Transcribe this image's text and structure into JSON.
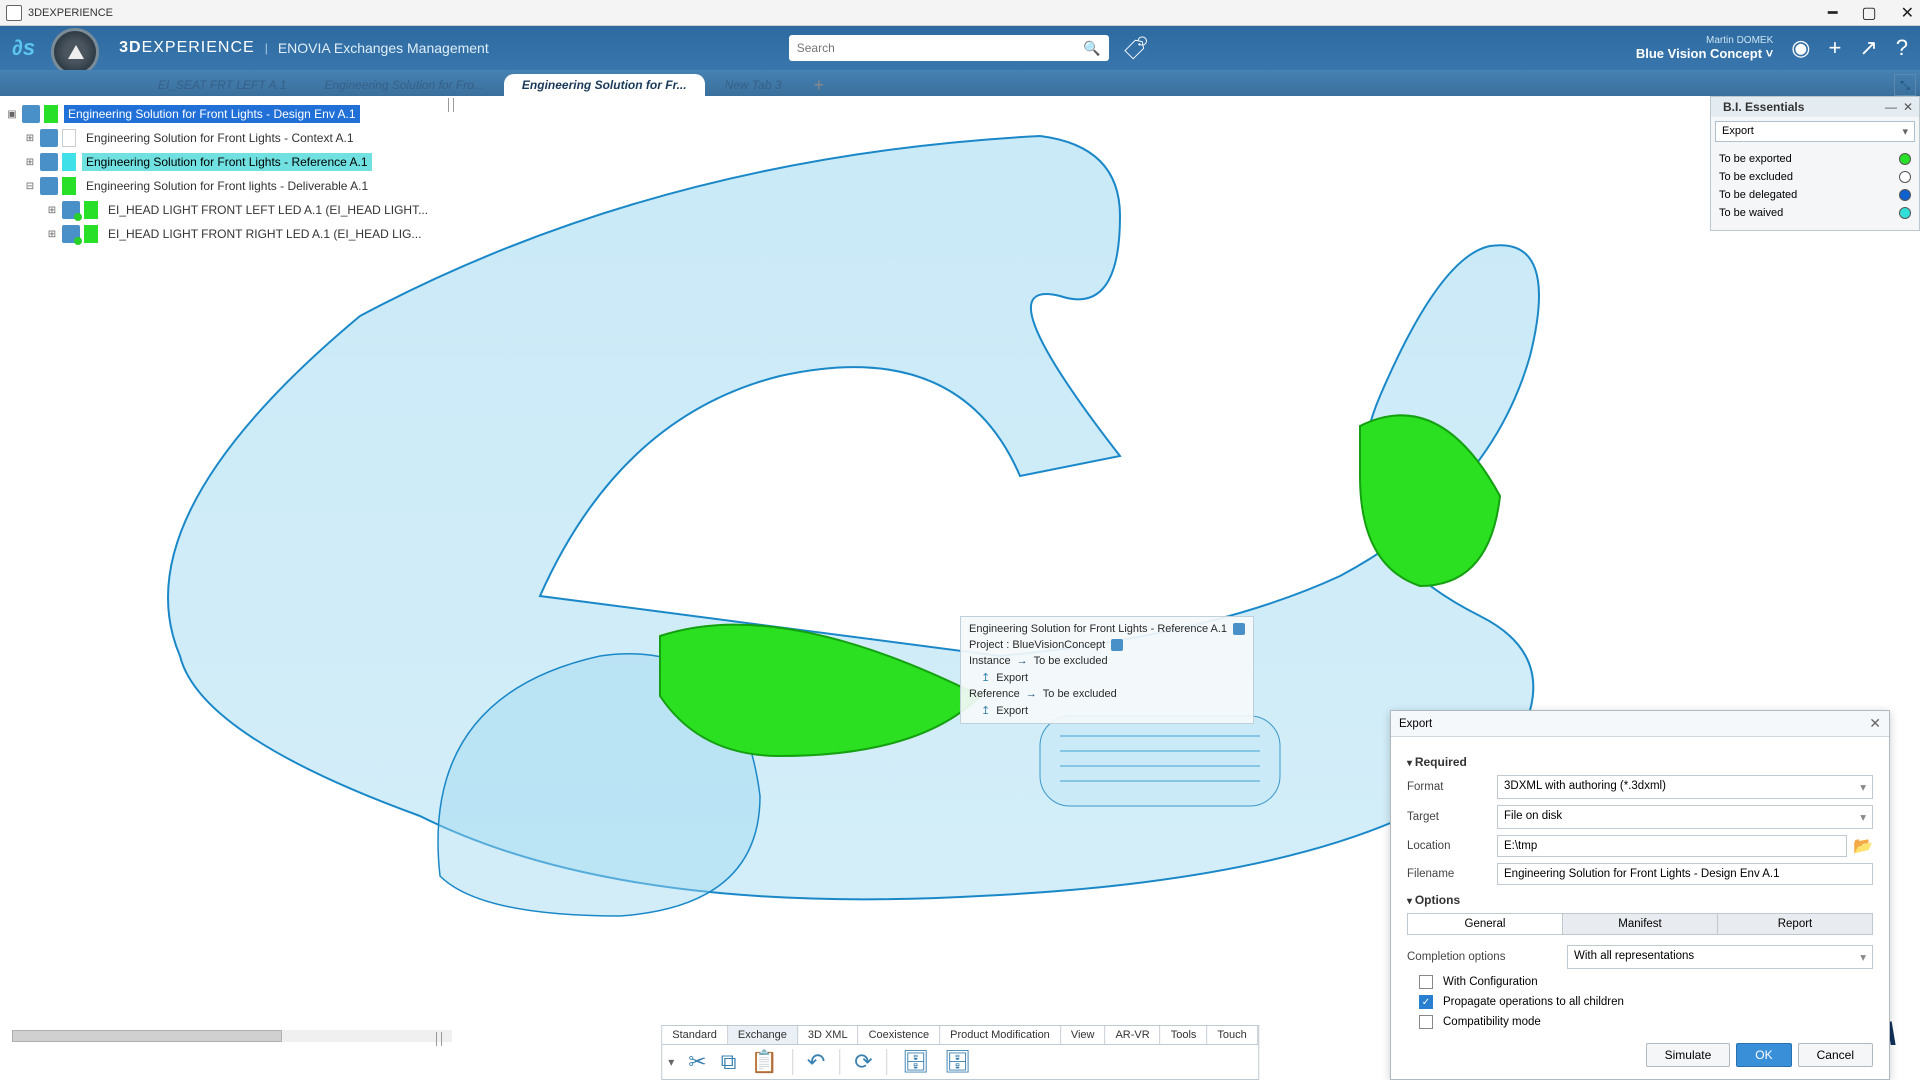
{
  "window": {
    "title": "3DEXPERIENCE"
  },
  "brand": {
    "product": "3D",
    "product_suffix": "EXPERIENCE",
    "divider": "|",
    "app": "ENOVIA",
    "app_sub": "Exchanges Management",
    "search_placeholder": "Search"
  },
  "user": {
    "name": "Martin DOMEK",
    "project": "Blue Vision Concept"
  },
  "tabs": [
    {
      "label": "EI_SEAT FRT LEFT A.1"
    },
    {
      "label": "Engineering Solution for Fro..."
    },
    {
      "label": "Engineering Solution for Fr..."
    },
    {
      "label": "New Tab 3"
    }
  ],
  "tree": {
    "nodes": [
      {
        "status": "green",
        "label": "Engineering Solution for Front Lights - Design Env A.1",
        "sel": "blue"
      },
      {
        "status": "blank",
        "label": "Engineering Solution for Front Lights - Context A.1"
      },
      {
        "status": "cyan",
        "label": "Engineering Solution for Front Lights - Reference A.1",
        "sel": "cyan"
      },
      {
        "status": "green",
        "label": "Engineering Solution for Front lights - Deliverable A.1"
      },
      {
        "status": "green",
        "label": "EI_HEAD LIGHT FRONT LEFT LED A.1 (EI_HEAD LIGHT..."
      },
      {
        "status": "green",
        "label": "EI_HEAD LIGHT FRONT RIGHT LED A.1 (EI_HEAD LIG..."
      }
    ]
  },
  "annotation": {
    "title": "Engineering Solution for Front Lights - Reference A.1",
    "project": "Project : BlueVisionConcept",
    "instance_label": "Instance",
    "instance_status": "To be excluded",
    "reference_label": "Reference",
    "reference_status": "To be excluded",
    "export_label": "Export"
  },
  "bi": {
    "title": "B.I. Essentials",
    "combo": "Export",
    "legend": [
      {
        "label": "To be exported",
        "color": "green"
      },
      {
        "label": "To be excluded",
        "color": "white"
      },
      {
        "label": "To be delegated",
        "color": "blue"
      },
      {
        "label": "To be waived",
        "color": "cyan"
      }
    ]
  },
  "export_dlg": {
    "title": "Export",
    "sections": {
      "required": "Required",
      "options": "Options"
    },
    "labels": {
      "format": "Format",
      "target": "Target",
      "location": "Location",
      "filename": "Filename",
      "completion": "Completion options"
    },
    "values": {
      "format": "3DXML with authoring (*.3dxml)",
      "target": "File on disk",
      "location": "E:\\tmp",
      "filename": "Engineering Solution for Front Lights - Design Env A.1",
      "completion": "With all representations"
    },
    "option_tabs": [
      "General",
      "Manifest",
      "Report"
    ],
    "checkboxes": {
      "with_config": "With Configuration",
      "propagate": "Propagate operations to all children",
      "compat": "Compatibility mode"
    },
    "buttons": {
      "simulate": "Simulate",
      "ok": "OK",
      "cancel": "Cancel"
    }
  },
  "bottom": {
    "tabs": [
      "Standard",
      "Exchange",
      "3D XML",
      "Coexistence",
      "Product Modification",
      "View",
      "AR-VR",
      "Tools",
      "Touch"
    ]
  },
  "logo_text": "ENOVIA"
}
